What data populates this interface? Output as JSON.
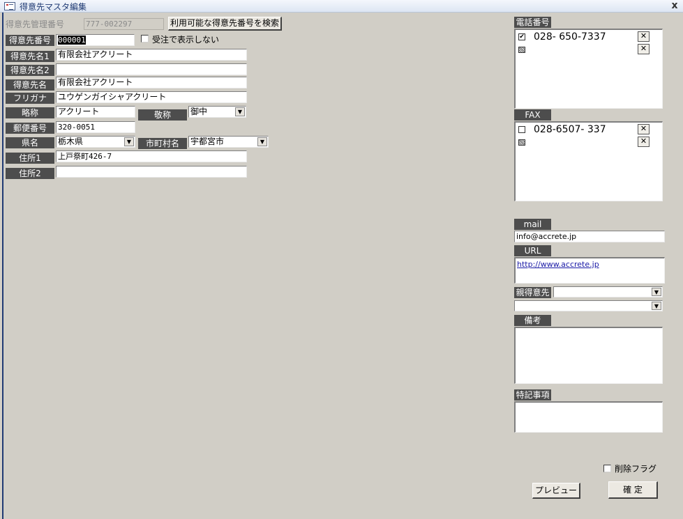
{
  "window": {
    "title": "得意先マスタ編集",
    "close_label": "x"
  },
  "header": {
    "mgmt_label": "得意先管理番号",
    "mgmt_value": "777-002297",
    "search_button": "利用可能な得意先番号を検索"
  },
  "form": {
    "customer_no_label": "得意先番号",
    "customer_no_value": "000001",
    "hide_orders_label": "受注で表示しない",
    "name1_label": "得意先名1",
    "name1_value": "有限会社アクリート",
    "name2_label": "得意先名2",
    "name2_value": "",
    "name_label": "得意先名",
    "name_value": "有限会社アクリート",
    "furigana_label": "フリガナ",
    "furigana_value": "ユウゲンガイシャアクリート",
    "abbr_label": "略称",
    "abbr_value": "アクリート",
    "honorific_label": "敬称",
    "honorific_value": "御中",
    "postal_label": "郵便番号",
    "postal_value": "320-0051",
    "pref_label": "県名",
    "pref_value": "栃木県",
    "city_label": "市町村名",
    "city_value": "宇都宮市",
    "addr1_label": "住所1",
    "addr1_value": "上戸祭町426-7",
    "addr2_label": "住所2",
    "addr2_value": ""
  },
  "side": {
    "phone_label": "電話番号",
    "phones": [
      {
        "checked": true,
        "number": "028- 650-7337"
      }
    ],
    "fax_label": "FAX",
    "faxes": [
      {
        "checked": false,
        "number": "028-6507- 337"
      }
    ],
    "dial_icon": "phone-dial-icon",
    "mail_label": "mail",
    "mail_value": "info@accrete.jp",
    "url_label": "URL",
    "url_value": "http://www.accrete.jp",
    "parent_label": "親得意先",
    "parent_value": "",
    "parent2_value": "",
    "remarks_label": "備考",
    "remarks_value": "",
    "notes_label": "特記事項",
    "notes_value": ""
  },
  "footer": {
    "delete_flag_label": "削除フラグ",
    "preview_button": "プレビュー",
    "confirm_button": "確 定"
  }
}
